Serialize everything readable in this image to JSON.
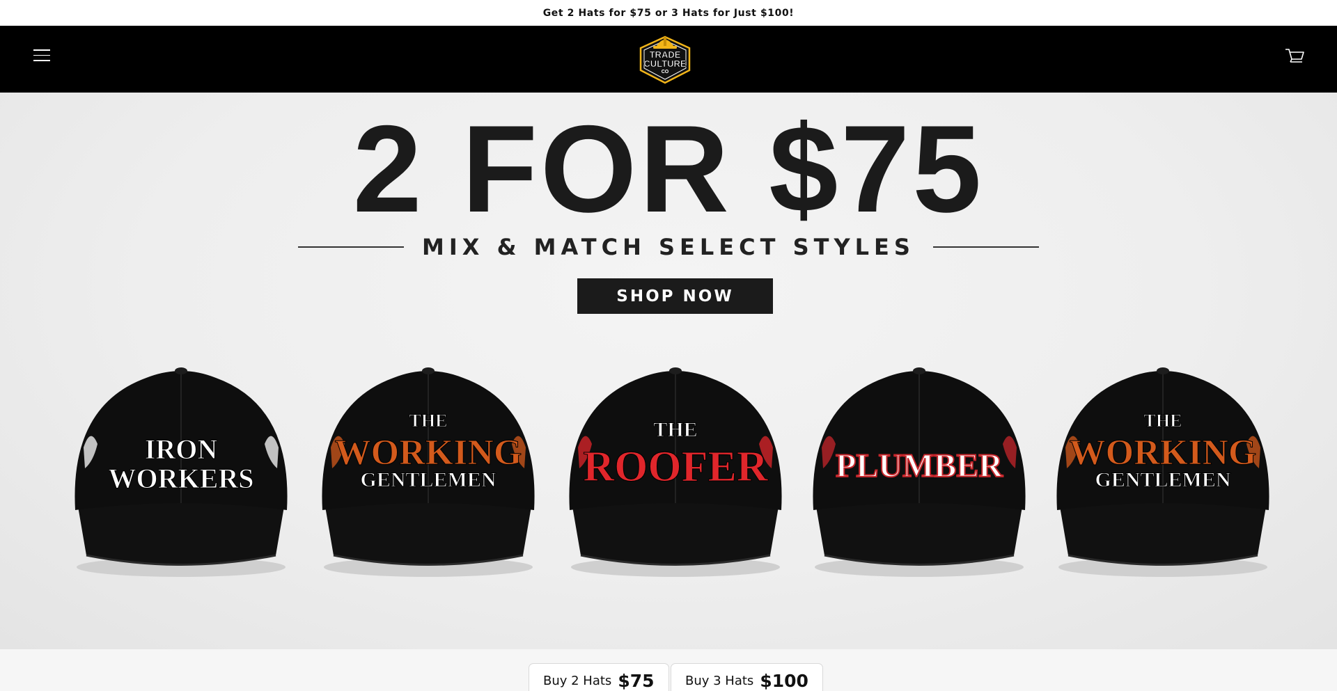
{
  "announcement": {
    "text": "Get 2 Hats for $75 or 3 Hats for Just $100!"
  },
  "header": {
    "menu_icon": "hamburger-menu-icon",
    "logo": {
      "line1": "TRADE",
      "line2": "CULTURE",
      "line3": "CO"
    },
    "cart_icon": "cart-icon"
  },
  "hero": {
    "headline": "2 FOR $75",
    "subline": "MIX & MATCH SELECT STYLES",
    "cta_label": "SHOP NOW",
    "hats": [
      {
        "lines": [
          "IRON",
          "WORKERS"
        ],
        "accent": "#ffffff"
      },
      {
        "lines": [
          "THE",
          "WORKING",
          "GENTLEMEN"
        ],
        "accent": "#d35a1c"
      },
      {
        "lines": [
          "THE",
          "ROOFER"
        ],
        "accent": "#e0262b"
      },
      {
        "lines": [
          "PLUMBER"
        ],
        "accent": "#c6262b"
      },
      {
        "lines": [
          "THE",
          "WORKING",
          "GENTLEMEN"
        ],
        "accent": "#d35a1c"
      }
    ]
  },
  "bundles": [
    {
      "label": "Buy 2 Hats",
      "price": "$75"
    },
    {
      "label": "Buy 3 Hats",
      "price": "$100"
    }
  ],
  "colors": {
    "header_bg": "#000000",
    "hero_bg": "#eeeeee",
    "cta_bg": "#1b1b1b",
    "logo_gold": "#f2b519"
  }
}
